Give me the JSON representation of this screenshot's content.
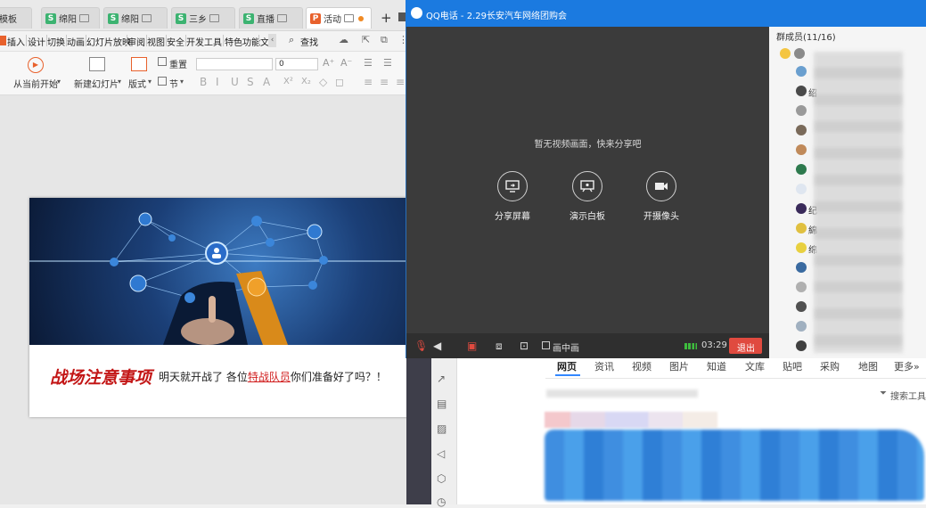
{
  "wps": {
    "tabs": [
      {
        "label": "模板",
        "icon": "none"
      },
      {
        "label": "绵阳",
        "icon": "W"
      },
      {
        "label": "绵阳",
        "icon": "W"
      },
      {
        "label": "三乡",
        "icon": "W"
      },
      {
        "label": "直播",
        "icon": "W"
      },
      {
        "label": "活动",
        "icon": "P"
      }
    ],
    "new_tab": "+",
    "menu": [
      "插入",
      "设计",
      "切换",
      "动画",
      "幻灯片放映",
      "审阅",
      "视图",
      "安全",
      "开发工具",
      "特色功能",
      "文"
    ],
    "search_label": "查找",
    "ribbon": {
      "play_from_current": "从当前开始",
      "new_slide": "新建幻灯片",
      "layout": "版式",
      "reset": "重置",
      "section": "节",
      "font_size": "0",
      "format_glyphs": [
        "B",
        "I",
        "U",
        "S",
        "A",
        "X²",
        "X₂"
      ]
    },
    "slide": {
      "title_calligraphy": "战场注意事项",
      "caption_pre": "明天就开战了 各位",
      "caption_highlight": "特战队员",
      "caption_post": "你们准备好了吗？！"
    }
  },
  "qq": {
    "title": "QQ电话 - 2.29长安汽车网络团购会",
    "empty_hint": "暂无视频画面，快来分享吧",
    "actions": [
      {
        "label": "分享屏幕",
        "icon": "share-screen-icon"
      },
      {
        "label": "演示白板",
        "icon": "whiteboard-icon"
      },
      {
        "label": "开摄像头",
        "icon": "camera-icon"
      }
    ],
    "pip_label": "画中画",
    "timer": "03:29",
    "exit_label": "退出",
    "members_header": "群成员(11/16)",
    "member_labels": [
      "",
      "",
      "绍",
      "",
      "",
      "",
      "",
      "纪",
      "綿",
      "绵",
      "",
      "",
      "",
      ""
    ]
  },
  "browser": {
    "nav": [
      "网页",
      "资讯",
      "视频",
      "图片",
      "知道",
      "文库",
      "贴吧",
      "采购",
      "地图",
      "更多»"
    ],
    "active_nav": "网页",
    "tools_label": "搜索工具"
  },
  "colors": {
    "qq_blue": "#1b7ae0",
    "exit_red": "#e04a3f",
    "highlight_red": "#d11f1f",
    "wps_orange": "#e8612c",
    "wps_green": "#3cb371"
  }
}
